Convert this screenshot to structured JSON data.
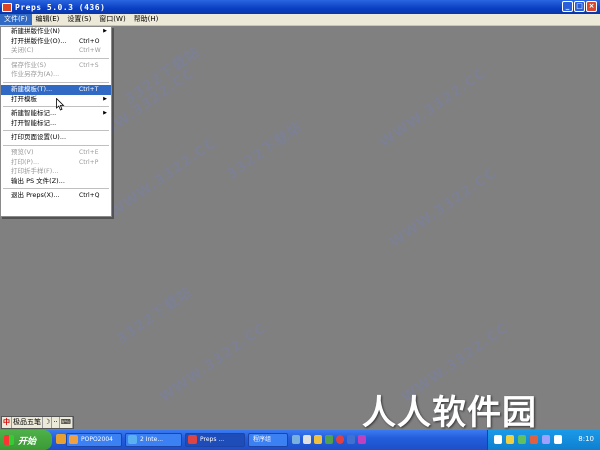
{
  "window": {
    "title": "Preps 5.0.3 (436)",
    "buttons": {
      "minimize": "_",
      "maximize": "□",
      "close": "×"
    }
  },
  "menubar": [
    "文件(F)",
    "编辑(E)",
    "设置(S)",
    "窗口(W)",
    "帮助(H)"
  ],
  "file_menu": {
    "items": [
      {
        "label": "新建拼版作业(N)",
        "shortcut": "",
        "submenu": true,
        "disabled": false
      },
      {
        "label": "打开拼版作业(O)...",
        "shortcut": "Ctrl+O",
        "disabled": false
      },
      {
        "label": "关闭(C)",
        "shortcut": "Ctrl+W",
        "disabled": true
      },
      {
        "label": "保存作业(S)",
        "shortcut": "Ctrl+S",
        "disabled": true
      },
      {
        "label": "作业另存为(A)...",
        "shortcut": "",
        "disabled": true
      },
      {
        "label": "新建模板(T)...",
        "shortcut": "Ctrl+T",
        "disabled": false,
        "highlighted": true
      },
      {
        "label": "打开模板",
        "shortcut": "",
        "submenu": true,
        "disabled": false
      },
      {
        "label": "新建智能标记...",
        "shortcut": "",
        "submenu": true,
        "disabled": false
      },
      {
        "label": "打开智能标记...",
        "shortcut": "",
        "disabled": false
      },
      {
        "label": "打印页面设置(U)...",
        "shortcut": "",
        "disabled": false
      },
      {
        "label": "预览(V)",
        "shortcut": "Ctrl+E",
        "disabled": true
      },
      {
        "label": "打印(P)...",
        "shortcut": "Ctrl+P",
        "disabled": true
      },
      {
        "label": "打印折手样(F)...",
        "shortcut": "",
        "disabled": true
      },
      {
        "label": "输出 PS 文件(Z)...",
        "shortcut": "",
        "disabled": false
      },
      {
        "label": "退出 Preps(X)...",
        "shortcut": "Ctrl+Q",
        "disabled": false
      }
    ]
  },
  "watermark": "3322下载站",
  "watermark2": "WWW.3322.CC",
  "ime": {
    "logo": "中",
    "name": "极品五笔",
    "moon": "☽",
    "dots": "··",
    "kb": "⌨"
  },
  "taskbar": {
    "start_label": "开始",
    "tasks": [
      "POPO2004",
      "2 Inte...",
      "Preps ...",
      "程序组"
    ],
    "clock": "8:10"
  },
  "brand": "人人软件园",
  "colors": {
    "titlebar": "#0a3fc4",
    "workspace": "#808080",
    "highlight": "#316ac5",
    "start": "#3a9a35"
  }
}
